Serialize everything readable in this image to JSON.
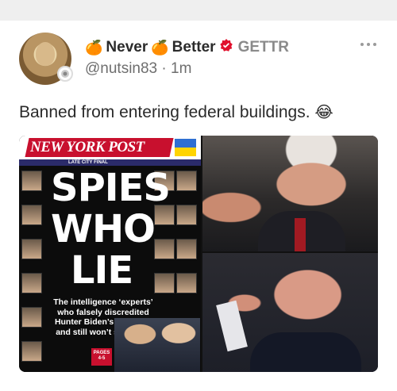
{
  "post": {
    "display_name_prefix": "🍊",
    "display_name_word1": "Never",
    "display_name_mid": "🍊",
    "display_name_word2": "Better",
    "verified_icon": "red-verified-badge",
    "platform": "GETTR",
    "handle": "@nutsin83",
    "separator": "·",
    "time": "1m",
    "text": "Banned from entering federal buildings.",
    "text_emoji": "😂",
    "more_icon": "three-dots-icon"
  },
  "cover": {
    "masthead": "NEW YORK POST",
    "edition": "LATE CITY FINAL",
    "headline_lines": [
      "SPIES",
      "WHO",
      "LIE"
    ],
    "subhead": "The intelligence ‘experts’ who falsely discredited Hunter Biden’s laptop — and still won’t say sorry",
    "pages_label": "PAGES 4-5",
    "colors": {
      "brand_red": "#c8102e",
      "flag_blue": "#2f6fd2",
      "flag_yellow": "#ffd400"
    }
  }
}
